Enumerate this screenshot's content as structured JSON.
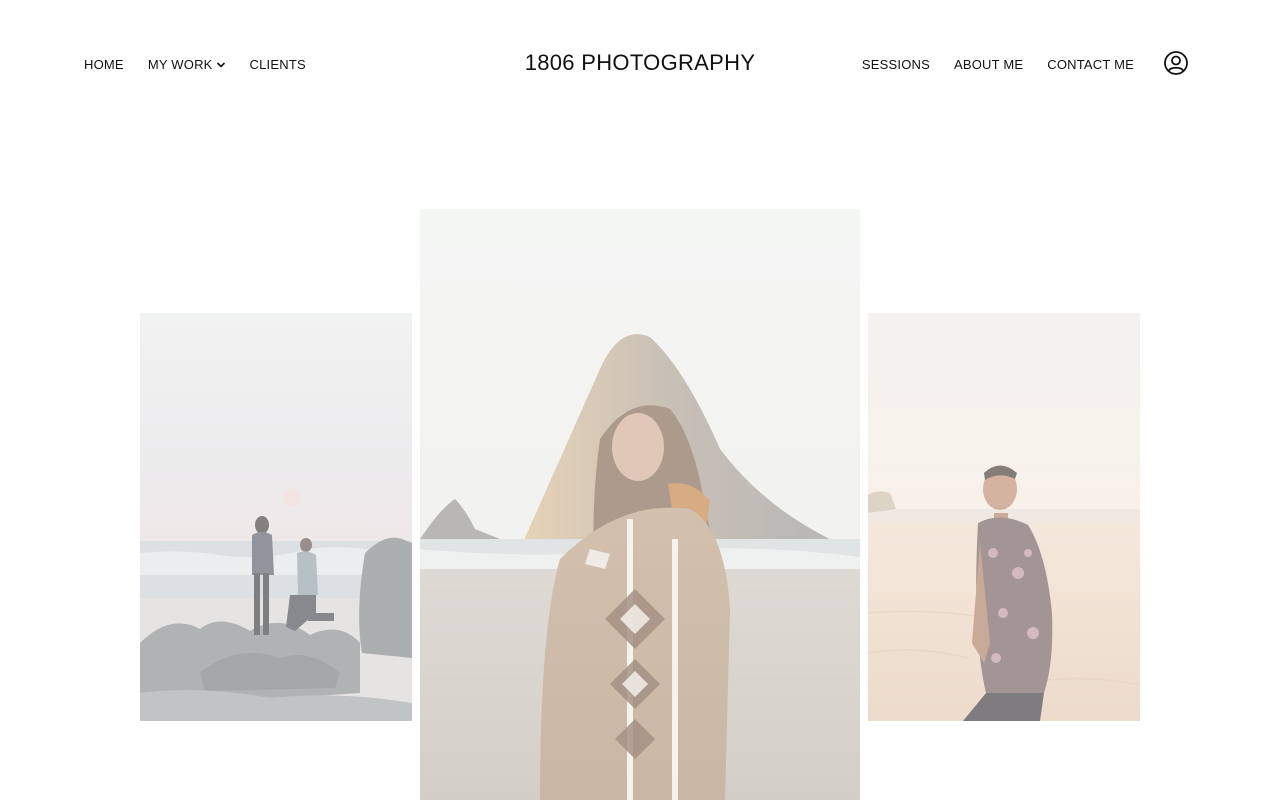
{
  "brand": {
    "title": "1806 PHOTOGRAPHY"
  },
  "nav": {
    "left": [
      {
        "label": "HOME"
      },
      {
        "label": "MY WORK",
        "has_dropdown": true
      },
      {
        "label": "CLIENTS"
      }
    ],
    "right": [
      {
        "label": "SESSIONS"
      },
      {
        "label": "ABOUT ME"
      },
      {
        "label": "CONTACT ME"
      }
    ],
    "account_icon": "user-circle-icon",
    "dropdown_icon": "chevron-down-icon"
  },
  "gallery": {
    "photos": [
      {
        "subject": "proposal-on-beach-rocks"
      },
      {
        "subject": "woman-in-blanket-haystack-rock"
      },
      {
        "subject": "smiling-man-floral-shirt-beach"
      }
    ]
  },
  "colors": {
    "text": "#111111",
    "background": "#ffffff"
  }
}
